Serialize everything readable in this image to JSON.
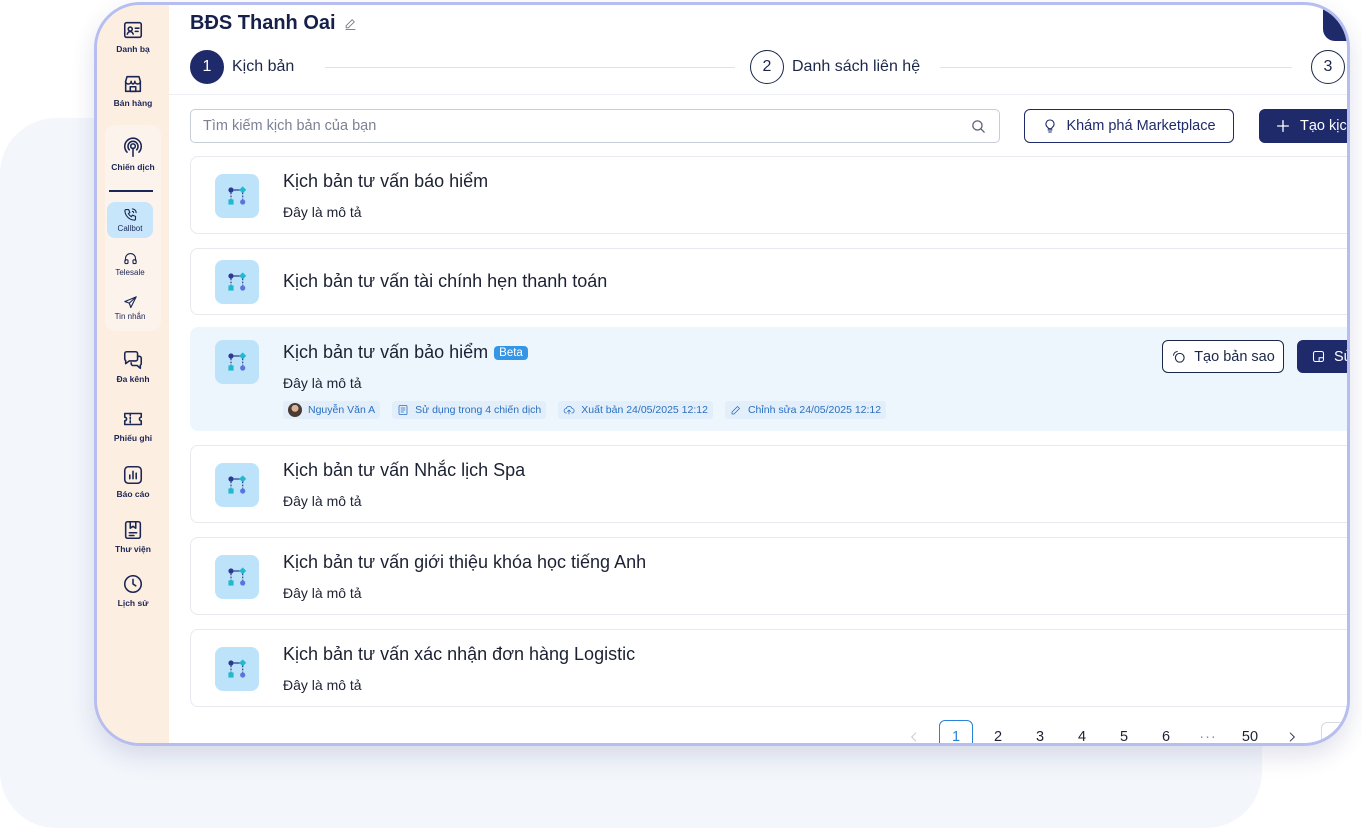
{
  "sidebar": {
    "items": [
      {
        "label": "Danh bạ",
        "icon": "contact-card-icon"
      },
      {
        "label": "Bán hàng",
        "icon": "store-icon"
      },
      {
        "label": "Chiến dịch",
        "icon": "broadcast-icon"
      },
      {
        "label": "Đa kênh",
        "icon": "chat-bubbles-icon"
      },
      {
        "label": "Phiếu ghi",
        "icon": "ticket-icon"
      },
      {
        "label": "Báo cáo",
        "icon": "bar-chart-icon"
      },
      {
        "label": "Thư viện",
        "icon": "library-icon"
      },
      {
        "label": "Lịch sử",
        "icon": "clock-icon"
      }
    ],
    "campaign_subitems": [
      {
        "label": "Callbot",
        "icon": "phone-call-icon",
        "active": true
      },
      {
        "label": "Telesale",
        "icon": "headset-icon",
        "active": false
      },
      {
        "label": "Tin nhắn",
        "icon": "send-icon",
        "active": false
      }
    ]
  },
  "header": {
    "title": "BĐS Thanh Oai",
    "steps": [
      {
        "number": "1",
        "label": "Kịch bản",
        "active": true
      },
      {
        "number": "2",
        "label": "Danh sách liên hệ",
        "active": false
      },
      {
        "number": "3",
        "label": "",
        "active": false
      }
    ]
  },
  "toolbar": {
    "search_placeholder": "Tìm kiếm kịch bản của bạn",
    "marketplace_label": "Khám phá Marketplace",
    "create_label": "Tạo kịch bản"
  },
  "scripts": [
    {
      "title": "Kịch bản tư vấn báo hiểm",
      "description": "Đây là mô tả"
    },
    {
      "title": "Kịch bản tư vấn tài chính hẹn thanh toán",
      "description": ""
    },
    {
      "title": "Kịch bản tư vấn bảo hiểm",
      "badge": "Beta",
      "description": "Đây là mô tả",
      "meta": {
        "author": "Nguyễn Văn A",
        "usage": "Sử dụng trong 4 chiến dịch",
        "published": "Xuất bản 24/05/2025 12:12",
        "edited": "Chỉnh sửa 24/05/2025 12:12"
      },
      "actions": {
        "copy_label": "Tạo bản sao",
        "edit_label": "Sửa"
      }
    },
    {
      "title": "Kịch bản tư vấn Nhắc lịch Spa",
      "description": "Đây là mô tả"
    },
    {
      "title": "Kịch bản tư vấn giới thiệu khóa học tiếng Anh",
      "description": "Đây là mô tả"
    },
    {
      "title": "Kịch bản tư vấn xác nhận đơn hàng Logistic",
      "description": "Đây là mô tả"
    }
  ],
  "pagination": {
    "pages": [
      "1",
      "2",
      "3",
      "4",
      "5",
      "6",
      "···",
      "50"
    ],
    "current": "1"
  },
  "colors": {
    "primary": "#1f2a6b",
    "accent": "#2b83d6",
    "sidebar_bg": "#fdeee2",
    "highlight_row": "#eef6fd",
    "badge": "#3596e6"
  }
}
